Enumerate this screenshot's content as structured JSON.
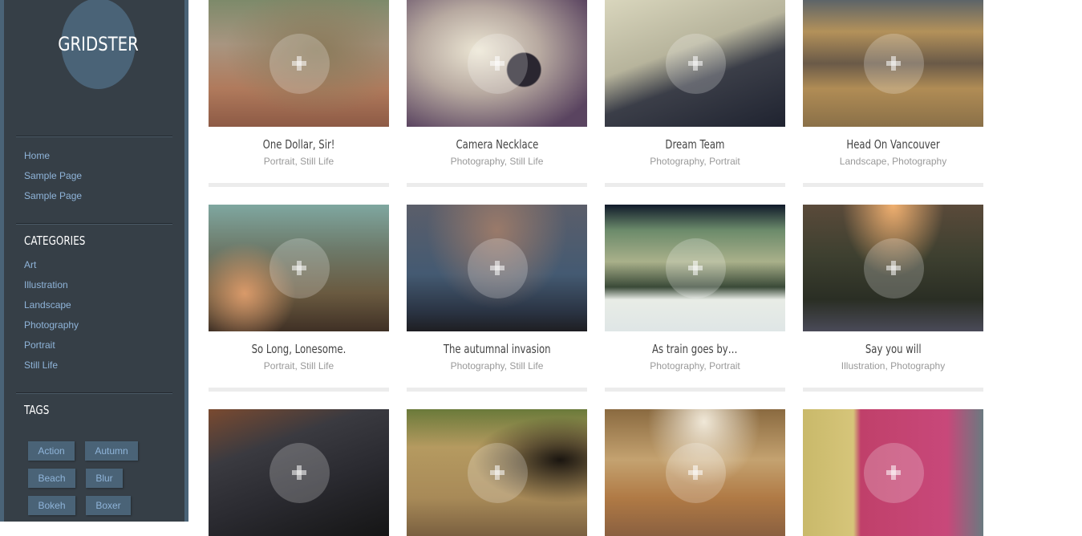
{
  "site": {
    "logo_text": "GRIDSTER"
  },
  "sidebar": {
    "pages": [
      {
        "label": "Home"
      },
      {
        "label": "Sample Page"
      },
      {
        "label": "Sample Page"
      }
    ],
    "categories_title": "CATEGORIES",
    "categories": [
      {
        "label": "Art"
      },
      {
        "label": "Illustration"
      },
      {
        "label": "Landscape"
      },
      {
        "label": "Photography"
      },
      {
        "label": "Portrait"
      },
      {
        "label": "Still Life"
      }
    ],
    "tags_title": "TAGS",
    "tags": [
      {
        "label": "Action"
      },
      {
        "label": "Autumn"
      },
      {
        "label": "Beach"
      },
      {
        "label": "Blur"
      },
      {
        "label": "Bokeh"
      },
      {
        "label": "Boxer"
      }
    ]
  },
  "colors": {
    "sidebar_bg": "#363f47",
    "sidebar_accent": "#4a6377",
    "link": "#8fb4d9",
    "card_bar": "#ececec"
  },
  "posts": [
    {
      "title": "One Dollar, Sir!",
      "categories": [
        "Portrait",
        "Still Life"
      ],
      "image": "laughing-girls-temple",
      "plus_icon": "plus-icon"
    },
    {
      "title": "Camera Necklace",
      "categories": [
        "Photography",
        "Still Life"
      ],
      "image": "camera-necklace-pine",
      "plus_icon": "plus-icon"
    },
    {
      "title": "Dream Team",
      "categories": [
        "Photography",
        "Portrait"
      ],
      "image": "surfers-wave",
      "plus_icon": "plus-icon"
    },
    {
      "title": "Head On Vancouver",
      "categories": [
        "Landscape",
        "Photography"
      ],
      "image": "vancouver-skyline",
      "plus_icon": "plus-icon"
    },
    {
      "title": "So Long, Lonesome.",
      "categories": [
        "Portrait",
        "Still Life"
      ],
      "image": "couple-field-guitar",
      "plus_icon": "plus-icon"
    },
    {
      "title": "The autumnal invasion",
      "categories": [
        "Photography",
        "Still Life"
      ],
      "image": "leaves-on-bench",
      "plus_icon": "plus-icon"
    },
    {
      "title": "As train goes by…",
      "categories": [
        "Photography",
        "Portrait"
      ],
      "image": "man-train-platform",
      "plus_icon": "plus-icon"
    },
    {
      "title": "Say you will",
      "categories": [
        "Illustration",
        "Photography"
      ],
      "image": "bokeh-grass",
      "plus_icon": "plus-icon"
    },
    {
      "title": "",
      "categories": [],
      "image": "tilt-shift-city",
      "plus_icon": "plus-icon"
    },
    {
      "title": "",
      "categories": [],
      "image": "girl-dog-beach",
      "plus_icon": "plus-icon"
    },
    {
      "title": "",
      "categories": [],
      "image": "couple-autumn-road",
      "plus_icon": "plus-icon"
    },
    {
      "title": "",
      "categories": [],
      "image": "marseille-soap",
      "plus_icon": "plus-icon"
    }
  ]
}
